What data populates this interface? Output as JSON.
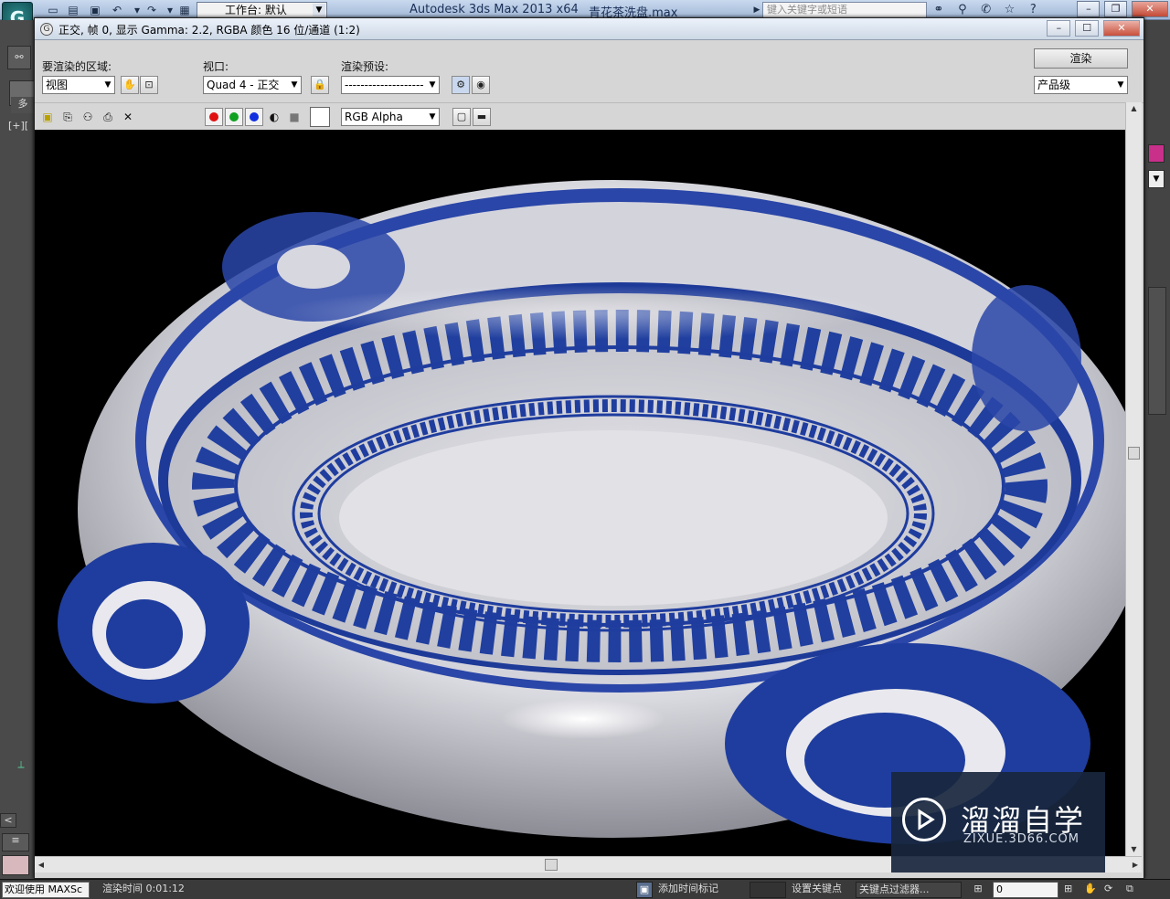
{
  "max_app": {
    "title": "Autodesk 3ds Max  2013 x64",
    "file": "青花茶洗盘.max",
    "workspace_label": "工作台: 默认",
    "search_placeholder": "键入关键字或短语",
    "logo_glyph": "G",
    "left_labels": [
      "多",
      "[+][",
      "<"
    ]
  },
  "render_frame": {
    "title": "正交, 帧 0, 显示 Gamma: 2.2, RGBA 颜色 16 位/通道 (1:2)",
    "area_label": "要渲染的区域:",
    "area_value": "视图",
    "viewport_label": "视口:",
    "viewport_value": "Quad 4 - 正交",
    "preset_label": "渲染预设:",
    "preset_value": "--------------------",
    "render_button": "渲染",
    "quality_value": "产品级",
    "channel_value": "RGB Alpha"
  },
  "watermark": {
    "title": "溜溜自学",
    "subtitle": "ZIXUE.3D66.COM"
  },
  "status": {
    "welcome": "欢迎使用 MAXSc",
    "render_time": "渲染时间  0:01:12",
    "add_time_tag": "添加时间标记",
    "set_key": "设置关键点",
    "key_filters": "关键点过滤器...",
    "frame_value": "0"
  },
  "colors": {
    "porcelain_blue": "#1f3d9e",
    "porcelain_white": "#e8e8ee",
    "ui_gray": "#d6d6d6",
    "accent_pink": "#c8308a"
  }
}
